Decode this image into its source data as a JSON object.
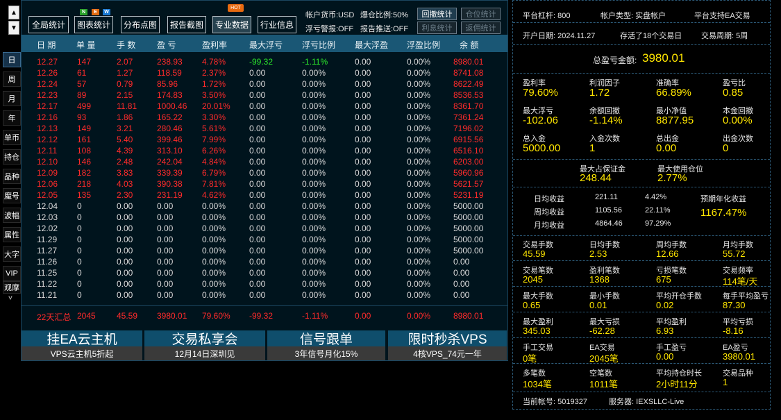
{
  "nav": {
    "up": "▲",
    "down": "▼",
    "more": "˅",
    "items": [
      "日",
      "周",
      "月",
      "年",
      "单币",
      "持仓",
      "品种",
      "魔号",
      "波幅",
      "属性",
      "大字",
      "VIP",
      "观摩"
    ]
  },
  "toolbar": {
    "buttons": [
      "全局统计",
      "图表统计",
      "分布点图",
      "报告截图",
      "专业数据",
      "行业信息"
    ],
    "hot": "HOT",
    "new": [
      "N",
      "E",
      "W"
    ],
    "currency": "帐户货币:USD",
    "ratio": "爆仓比例:50%",
    "float_alert": "浮亏警报:OFF",
    "push": "报告推送:OFF",
    "small": [
      "回撤统计",
      "仓位统计",
      "利息统计",
      "返佣统计"
    ]
  },
  "table": {
    "headers": [
      "日 期",
      "单 量",
      "手 数",
      "盈 亏",
      "盈利率",
      "最大浮亏",
      "浮亏比例",
      "最大浮盈",
      "浮盈比例",
      "余 额"
    ],
    "rows": [
      [
        "12.27",
        "147",
        "2.07",
        "238.93",
        "4.78%",
        "-99.32",
        "-1.11%",
        "0.00",
        "0.00%",
        "8980.01"
      ],
      [
        "12.26",
        "61",
        "1.27",
        "118.59",
        "2.37%",
        "0.00",
        "0.00%",
        "0.00",
        "0.00%",
        "8741.08"
      ],
      [
        "12.24",
        "57",
        "0.79",
        "85.96",
        "1.72%",
        "0.00",
        "0.00%",
        "0.00",
        "0.00%",
        "8622.49"
      ],
      [
        "12.23",
        "89",
        "2.15",
        "174.83",
        "3.50%",
        "0.00",
        "0.00%",
        "0.00",
        "0.00%",
        "8536.53"
      ],
      [
        "12.17",
        "499",
        "11.81",
        "1000.46",
        "20.01%",
        "0.00",
        "0.00%",
        "0.00",
        "0.00%",
        "8361.70"
      ],
      [
        "12.16",
        "93",
        "1.86",
        "165.22",
        "3.30%",
        "0.00",
        "0.00%",
        "0.00",
        "0.00%",
        "7361.24"
      ],
      [
        "12.13",
        "149",
        "3.21",
        "280.46",
        "5.61%",
        "0.00",
        "0.00%",
        "0.00",
        "0.00%",
        "7196.02"
      ],
      [
        "12.12",
        "161",
        "5.40",
        "399.46",
        "7.99%",
        "0.00",
        "0.00%",
        "0.00",
        "0.00%",
        "6915.56"
      ],
      [
        "12.11",
        "108",
        "4.39",
        "313.10",
        "6.26%",
        "0.00",
        "0.00%",
        "0.00",
        "0.00%",
        "6516.10"
      ],
      [
        "12.10",
        "146",
        "2.48",
        "242.04",
        "4.84%",
        "0.00",
        "0.00%",
        "0.00",
        "0.00%",
        "6203.00"
      ],
      [
        "12.09",
        "182",
        "3.83",
        "339.39",
        "6.79%",
        "0.00",
        "0.00%",
        "0.00",
        "0.00%",
        "5960.96"
      ],
      [
        "12.06",
        "218",
        "4.03",
        "390.38",
        "7.81%",
        "0.00",
        "0.00%",
        "0.00",
        "0.00%",
        "5621.57"
      ],
      [
        "12.05",
        "135",
        "2.30",
        "231.19",
        "4.62%",
        "0.00",
        "0.00%",
        "0.00",
        "0.00%",
        "5231.19"
      ],
      [
        "12.04",
        "0",
        "0.00",
        "0.00",
        "0.00%",
        "0.00",
        "0.00%",
        "0.00",
        "0.00%",
        "5000.00"
      ],
      [
        "12.03",
        "0",
        "0.00",
        "0.00",
        "0.00%",
        "0.00",
        "0.00%",
        "0.00",
        "0.00%",
        "5000.00"
      ],
      [
        "12.02",
        "0",
        "0.00",
        "0.00",
        "0.00%",
        "0.00",
        "0.00%",
        "0.00",
        "0.00%",
        "5000.00"
      ],
      [
        "11.29",
        "0",
        "0.00",
        "0.00",
        "0.00%",
        "0.00",
        "0.00%",
        "0.00",
        "0.00%",
        "5000.00"
      ],
      [
        "11.27",
        "0",
        "0.00",
        "0.00",
        "0.00%",
        "0.00",
        "0.00%",
        "0.00",
        "0.00%",
        "5000.00"
      ],
      [
        "11.26",
        "0",
        "0.00",
        "0.00",
        "0.00%",
        "0.00",
        "0.00%",
        "0.00",
        "0.00%",
        "0.00"
      ],
      [
        "11.25",
        "0",
        "0.00",
        "0.00",
        "0.00%",
        "0.00",
        "0.00%",
        "0.00",
        "0.00%",
        "0.00"
      ],
      [
        "11.22",
        "0",
        "0.00",
        "0.00",
        "0.00%",
        "0.00",
        "0.00%",
        "0.00",
        "0.00%",
        "0.00"
      ],
      [
        "11.21",
        "0",
        "0.00",
        "0.00",
        "0.00%",
        "0.00",
        "0.00%",
        "0.00",
        "0.00%",
        "0.00"
      ]
    ],
    "summary": [
      "22天汇总",
      "2045",
      "45.59",
      "3980.01",
      "79.60%",
      "-99.32",
      "-1.11%",
      "0.00",
      "0.00%",
      "8980.01"
    ]
  },
  "banners": [
    {
      "title": "挂EA云主机",
      "sub": "VPS云主机5折起"
    },
    {
      "title": "交易私享会",
      "sub": "12月14日深圳见"
    },
    {
      "title": "信号跟单",
      "sub": "3年信号月化15%"
    },
    {
      "title": "限时秒杀VPS",
      "sub": "4核VPS_74元一年"
    }
  ],
  "right": {
    "leverage": "平台杠杆: 800",
    "acct_type": "帐户类型: 实盘帐户",
    "ea_support": "平台支持EA交易",
    "open_date": "开户日期: 2024.11.27",
    "trade_days": "存活了18个交易日",
    "period": "交易周期: 5周",
    "total_label": "总盈亏金额:",
    "total_value": "3980.01",
    "g1": [
      {
        "l": "盈利率",
        "v": "79.60%"
      },
      {
        "l": "利润因子",
        "v": "1.72"
      },
      {
        "l": "准确率",
        "v": "66.89%"
      },
      {
        "l": "盈亏比",
        "v": "0.85"
      },
      {
        "l": "最大浮亏",
        "v": "-102.06"
      },
      {
        "l": "余额回撤",
        "v": "-1.14%"
      },
      {
        "l": "最小净值",
        "v": "8877.95"
      },
      {
        "l": "本金回撤",
        "v": "0.00%"
      },
      {
        "l": "总入金",
        "v": "5000.00"
      },
      {
        "l": "入金次数",
        "v": "1"
      },
      {
        "l": "总出金",
        "v": "0.00"
      },
      {
        "l": "出金次数",
        "v": "0"
      }
    ],
    "margin_label": "最大占保证金",
    "margin_value": "248.44",
    "pos_label": "最大使用仓位",
    "pos_value": "2.77%",
    "avg": [
      {
        "l": "日均收益",
        "a": "221.11",
        "p": "4.42%"
      },
      {
        "l": "周均收益",
        "a": "1105.56",
        "p": "22.11%"
      },
      {
        "l": "月均收益",
        "a": "4864.46",
        "p": "97.29%"
      }
    ],
    "annual_label": "预期年化收益",
    "annual_value": "1167.47%",
    "g2": [
      {
        "l": "交易手数",
        "v": "45.59"
      },
      {
        "l": "日均手数",
        "v": "2.53"
      },
      {
        "l": "周均手数",
        "v": "12.66"
      },
      {
        "l": "月均手数",
        "v": "55.72"
      },
      {
        "l": "交易笔数",
        "v": "2045"
      },
      {
        "l": "盈利笔数",
        "v": "1368"
      },
      {
        "l": "亏损笔数",
        "v": "675"
      },
      {
        "l": "交易频率",
        "v": "114笔/天"
      },
      {
        "l": "最大手数",
        "v": "0.65"
      },
      {
        "l": "最小手数",
        "v": "0.01"
      },
      {
        "l": "平均开仓手数",
        "v": "0.02"
      },
      {
        "l": "每手平均盈亏",
        "v": "87.30"
      },
      {
        "l": "最大盈利",
        "v": "345.03"
      },
      {
        "l": "最大亏损",
        "v": "-62.28"
      },
      {
        "l": "平均盈利",
        "v": "6.93"
      },
      {
        "l": "平均亏损",
        "v": "-8.16"
      },
      {
        "l": "手工交易",
        "v": "0笔"
      },
      {
        "l": "EA交易",
        "v": "2045笔"
      },
      {
        "l": "手工盈亏",
        "v": "0.00"
      },
      {
        "l": "EA盈亏",
        "v": "3980.01"
      },
      {
        "l": "多笔数",
        "v": "1034笔"
      },
      {
        "l": "空笔数",
        "v": "1011笔"
      },
      {
        "l": "平均持仓时长",
        "v": "2小时11分"
      },
      {
        "l": "交易品种",
        "v": "1"
      }
    ],
    "account": "当前帐号: 5019327",
    "server": "服务器: IEXSLLC-Live"
  },
  "colors": {
    "positive": "#ff2b2b",
    "negative": "#2bea2b",
    "value": "#ffe600",
    "header": "#1a5775",
    "banner": "#0f4e6c"
  }
}
